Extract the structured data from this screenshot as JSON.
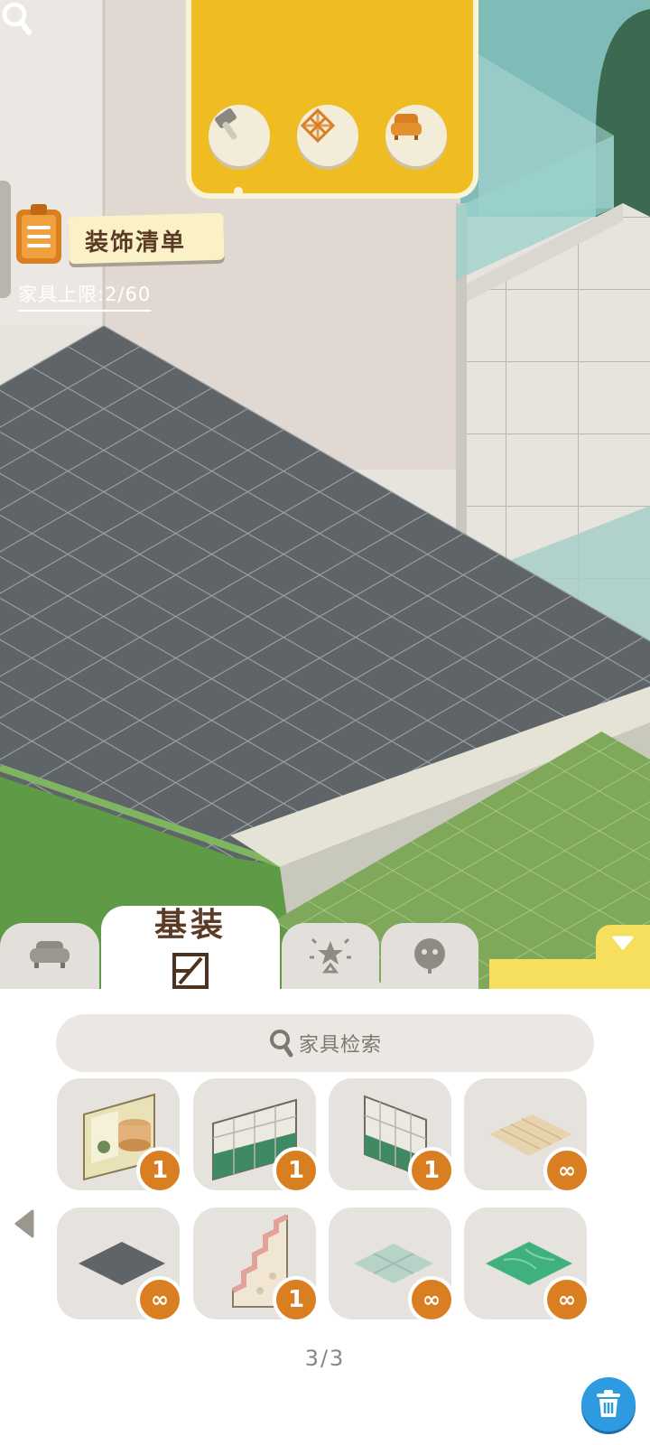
{
  "decoration_list": {
    "label": "装饰清单"
  },
  "furniture_limit": {
    "label": "家具上限:",
    "used": "2",
    "max": "60",
    "text": "家具上限:2/60"
  },
  "top_tools": [
    {
      "icon": "hammer-icon"
    },
    {
      "icon": "wallpaper-pattern-icon"
    },
    {
      "icon": "armchair-icon"
    }
  ],
  "tabs": [
    {
      "icon": "sofa-icon",
      "active": false
    },
    {
      "label": "基装",
      "icon": "wall-floor-icon",
      "active": true
    },
    {
      "icon": "lamp-star-icon",
      "active": false
    },
    {
      "icon": "face-sticker-icon",
      "active": false
    }
  ],
  "search": {
    "placeholder": "家具检索"
  },
  "items": [
    {
      "name": "window-wall-with-cake",
      "count": "1"
    },
    {
      "name": "white-green-tile-wall",
      "count": "1"
    },
    {
      "name": "white-green-tile-wall-corner",
      "count": "1"
    },
    {
      "name": "wood-floor",
      "count": "∞"
    },
    {
      "name": "dark-gray-floor",
      "count": "∞"
    },
    {
      "name": "pink-staircase",
      "count": "1"
    },
    {
      "name": "light-tile-floor",
      "count": "∞"
    },
    {
      "name": "green-marble-floor",
      "count": "∞"
    }
  ],
  "pagination": {
    "text": "3/3"
  },
  "colors": {
    "accent": "#efbd22",
    "badge": "#d97f22",
    "trash": "#2e9ae0",
    "floor": "#5e6468"
  }
}
